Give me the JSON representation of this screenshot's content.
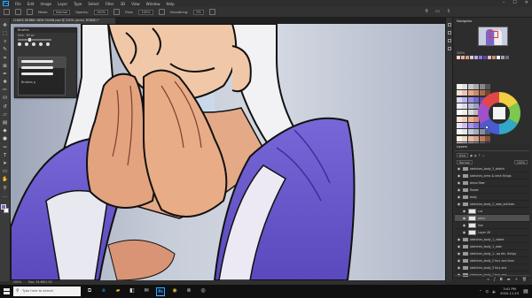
{
  "menubar": {
    "app_icon": "Ps",
    "items": [
      "File",
      "Edit",
      "Image",
      "Layer",
      "Type",
      "Select",
      "Filter",
      "3D",
      "View",
      "Window",
      "Help"
    ]
  },
  "optbar": {
    "mode_label": "Mode:",
    "mode_value": "Normal",
    "opacity_label": "Opacity:",
    "opacity_value": "100%",
    "flow_label": "Flow:",
    "flow_value": "100%",
    "smoothing_label": "Smoothing:",
    "smoothing_value": "0%"
  },
  "tab": {
    "title": "CHARS DEBBIE NEW 00438.psd @ 200% (arms, RGB/8) *"
  },
  "brush_panel": {
    "title": "Brushes",
    "size_label": "Size:",
    "size_value": "60 px",
    "group_label": "Brushes g"
  },
  "navigator": {
    "title": "Navigator",
    "zoom": "200%"
  },
  "layers": {
    "title": "Layers",
    "kind_label": "Kind",
    "blend_mode": "Normal",
    "opacity": "100%",
    "fill_label": "Fill:",
    "items": [
      {
        "name": "sketches_body_3_sketch",
        "type": "folder",
        "indent": false
      },
      {
        "name": "sketches_arms & neck things",
        "type": "folder",
        "indent": false
      },
      {
        "name": "dress fiber",
        "type": "folder",
        "indent": false
      },
      {
        "name": "flower",
        "type": "folder",
        "indent": false
      },
      {
        "name": "body",
        "type": "folder",
        "indent": false
      },
      {
        "name": "sketches_body_2_robe_outlines",
        "type": "folder",
        "indent": false
      },
      {
        "name": "cut",
        "type": "layer",
        "indent": true
      },
      {
        "name": "arms",
        "type": "layer",
        "indent": true,
        "selected": true
      },
      {
        "name": "line",
        "type": "layer",
        "indent": true
      },
      {
        "name": "Layer 49",
        "type": "layer",
        "indent": true
      },
      {
        "name": "sketches_body_1_naked",
        "type": "folder",
        "indent": false
      },
      {
        "name": "sketches_body_1_robe",
        "type": "folder",
        "indent": false
      },
      {
        "name": "sketches_body_1...ap etc. things",
        "type": "folder",
        "indent": false
      },
      {
        "name": "sketches_body_2 fury one lines",
        "type": "folder",
        "indent": false
      },
      {
        "name": "sketches_body_3 fury one",
        "type": "folder",
        "indent": false
      },
      {
        "name": "sketches_body_2 fury one",
        "type": "folder",
        "indent": false
      }
    ]
  },
  "statusbar": {
    "zoom": "200%",
    "doc": "Doc: 34.6M/1.3G"
  },
  "taskbar": {
    "search_placeholder": "Type here to search",
    "time": "3:41 PM",
    "date": "2020-11-23"
  },
  "colors": {
    "robe": "#7060d0",
    "skin": "#e0a37c",
    "background": "#b4bbca",
    "accent": "#31a8ff"
  }
}
